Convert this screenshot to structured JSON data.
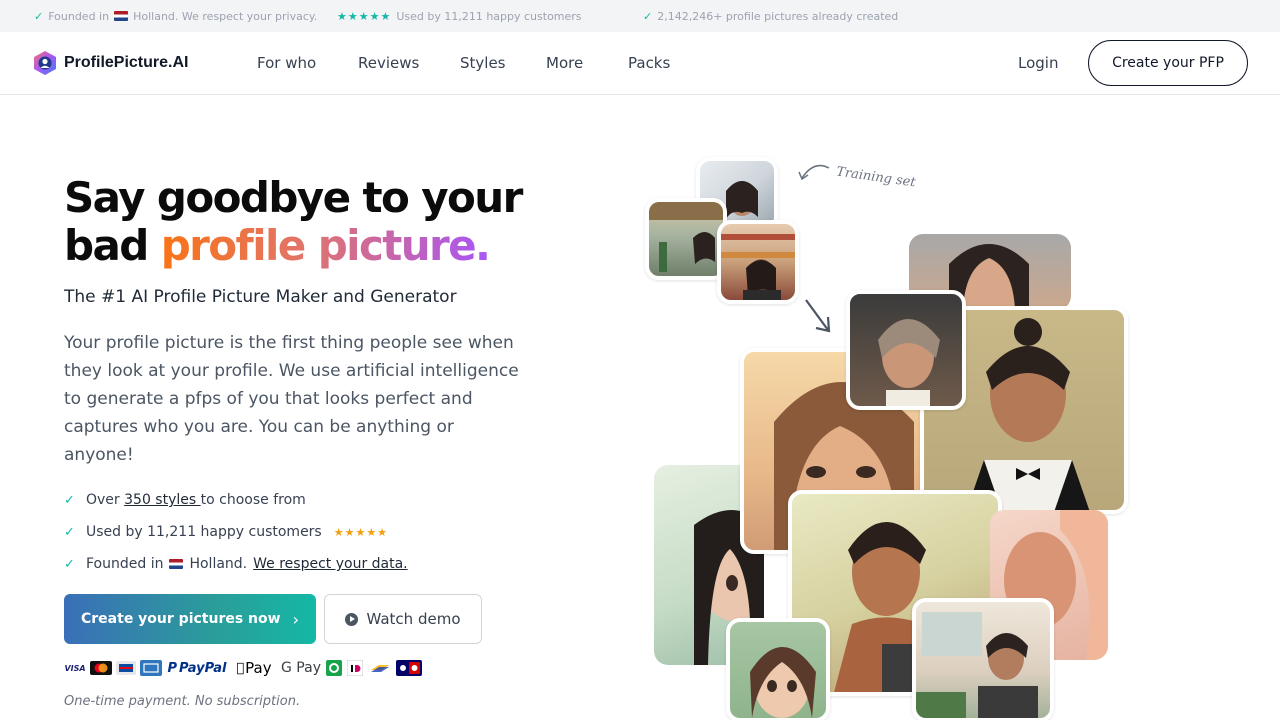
{
  "topbar": {
    "founded_prefix": "Founded in",
    "founded_suffix": "Holland. We respect your privacy.",
    "stars": "★★★★★",
    "used_by": "Used by 11,211 happy customers",
    "created": "2,142,246+ profile pictures already created"
  },
  "header": {
    "logo_text": "ProfilePicture.AI",
    "nav": [
      "For who",
      "Reviews",
      "Styles",
      "More",
      "Packs"
    ],
    "login": "Login",
    "cta": "Create your PFP"
  },
  "hero": {
    "title_line1": "Say goodbye to your",
    "title_line2_plain": "bad ",
    "title_line2_highlight": "profile picture.",
    "subtitle": "The #1 AI Profile Picture Maker and Generator",
    "description": "Your profile picture is the first thing people see when they look at your profile. We use artificial intelligence to generate a pfps of you that looks perfect and captures who you are. You can be anything or anyone!",
    "features": {
      "styles_prefix": "Over ",
      "styles_link": "350 styles ",
      "styles_suffix": "to choose from",
      "customers": "Used by 11,211 happy customers",
      "stars": "★★★★★",
      "founded_prefix": "Founded in",
      "founded_mid": "Holland.",
      "founded_link": "We respect your data."
    },
    "primary_button": "Create your pictures now",
    "primary_chevron": "›",
    "secondary_button": "Watch demo",
    "payment_note": "One-time payment. No subscription.",
    "payment_methods": [
      "VISA",
      "PayPal",
      "Pay",
      "G Pay"
    ]
  },
  "collage": {
    "training_label": "Training set"
  },
  "colors": {
    "accent_teal": "#14b8a6",
    "gradient_orange": "#f97316",
    "gradient_purple": "#a855f7",
    "star_orange": "#f59e0b"
  }
}
